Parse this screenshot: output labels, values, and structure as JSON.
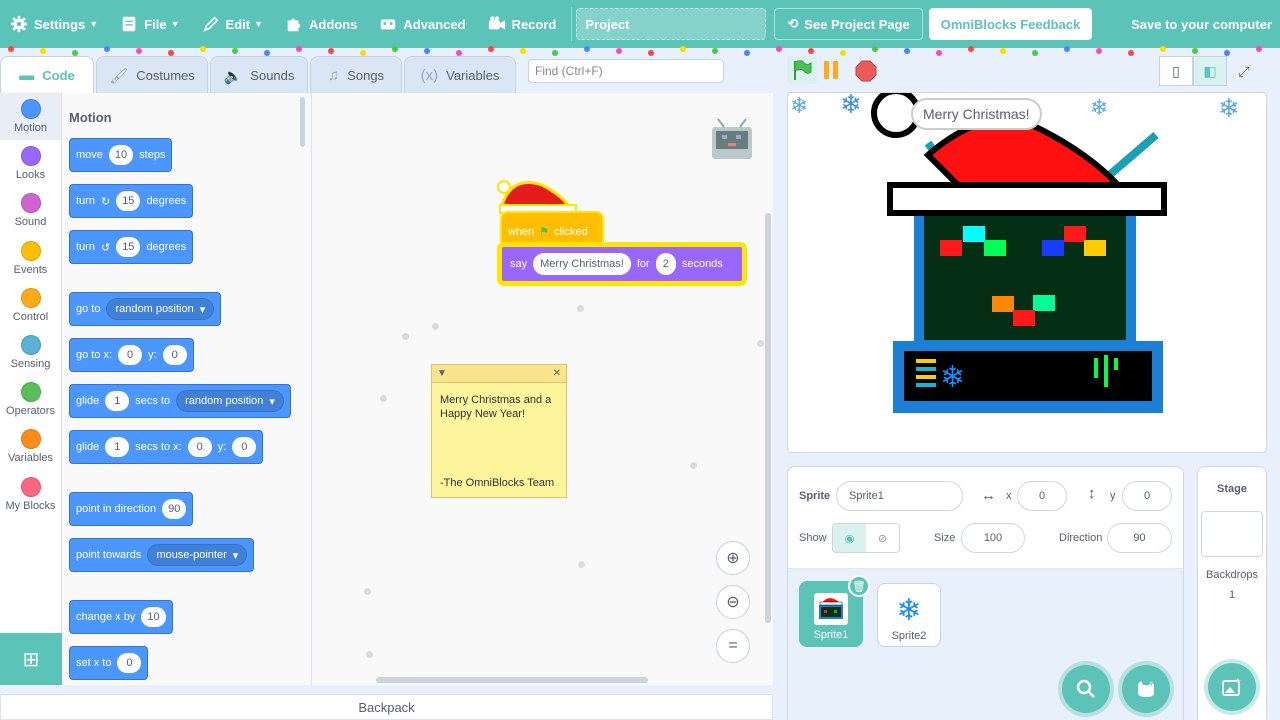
{
  "menu": {
    "settings": "Settings",
    "file": "File",
    "edit": "Edit",
    "addons": "Addons",
    "advanced": "Advanced",
    "record": "Record",
    "project_title": "Project",
    "see_project_page": "See Project Page",
    "feedback": "OmniBlocks Feedback",
    "save": "Save to your computer"
  },
  "tabs": [
    "Code",
    "Costumes",
    "Sounds",
    "Songs",
    "Variables"
  ],
  "find_placeholder": "Find (Ctrl+F)",
  "categories": [
    {
      "label": "Motion",
      "color": "#4c97ff"
    },
    {
      "label": "Looks",
      "color": "#9966ff"
    },
    {
      "label": "Sound",
      "color": "#cf63cf"
    },
    {
      "label": "Events",
      "color": "#ffbf00"
    },
    {
      "label": "Control",
      "color": "#ffab19"
    },
    {
      "label": "Sensing",
      "color": "#5cb1d6"
    },
    {
      "label": "Operators",
      "color": "#59c059"
    },
    {
      "label": "Variables",
      "color": "#ff8c1a"
    },
    {
      "label": "My Blocks",
      "color": "#ff6680"
    }
  ],
  "palette": {
    "title": "Motion",
    "move": {
      "a": "move",
      "v": "10",
      "b": "steps"
    },
    "turn_cw": {
      "a": "turn",
      "v": "15",
      "b": "degrees"
    },
    "turn_ccw": {
      "a": "turn",
      "v": "15",
      "b": "degrees"
    },
    "goto": {
      "a": "go to",
      "d": "random position"
    },
    "gotoxy": {
      "a": "go to x:",
      "x": "0",
      "yl": "y:",
      "y": "0"
    },
    "glide": {
      "a": "glide",
      "v": "1",
      "b": "secs to",
      "d": "random position"
    },
    "glidexy": {
      "a": "glide",
      "v": "1",
      "b": "secs to x:",
      "x": "0",
      "yl": "y:",
      "y": "0"
    },
    "point_dir": {
      "a": "point in direction",
      "v": "90"
    },
    "point_towards": {
      "a": "point towards",
      "d": "mouse-pointer"
    },
    "change_x": {
      "a": "change x by",
      "v": "10"
    },
    "set_x": {
      "a": "set x to",
      "v": "0"
    }
  },
  "script": {
    "hat_when": "when",
    "hat_clicked": "clicked",
    "say": "say",
    "say_text": "Merry Christmas!",
    "for": "for",
    "secs": "2",
    "seconds": "seconds"
  },
  "note": {
    "line1": "Merry Christmas and a Happy New Year!",
    "sign": "-The OmniBlocks Team"
  },
  "backpack": "Backpack",
  "stage": {
    "bubble": "Merry Christmas!"
  },
  "sprite_info": {
    "sprite_label": "Sprite",
    "sprite_name": "Sprite1",
    "x_label": "x",
    "x": "0",
    "y_label": "y",
    "y": "0",
    "show_label": "Show",
    "size_label": "Size",
    "size": "100",
    "direction_label": "Direction",
    "direction": "90"
  },
  "sprites": [
    "Sprite1",
    "Sprite2"
  ],
  "stage_pane": {
    "title": "Stage",
    "backdrops_label": "Backdrops",
    "backdrops_count": "1"
  }
}
